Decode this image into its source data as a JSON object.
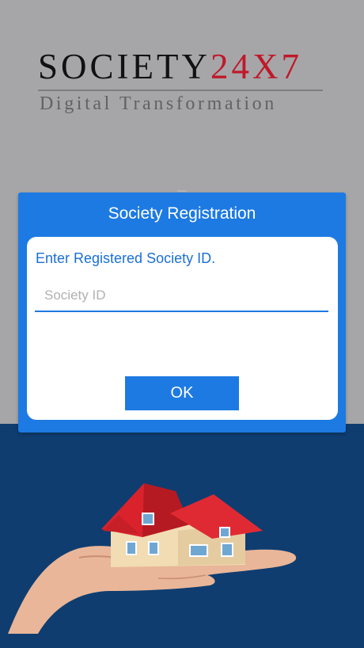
{
  "logo": {
    "name_part": "SOCIETY",
    "number_part": "24X7",
    "tagline": "Digital Transformation",
    "accent_color": "#c0182a"
  },
  "dialog": {
    "title": "Society Registration",
    "prompt": "Enter Registered Society ID.",
    "field_placeholder": "Society ID",
    "field_value": "",
    "ok_label": "OK",
    "accent_color": "#1d7ae2"
  },
  "illustration": {
    "icon": "house-in-hand-icon"
  }
}
